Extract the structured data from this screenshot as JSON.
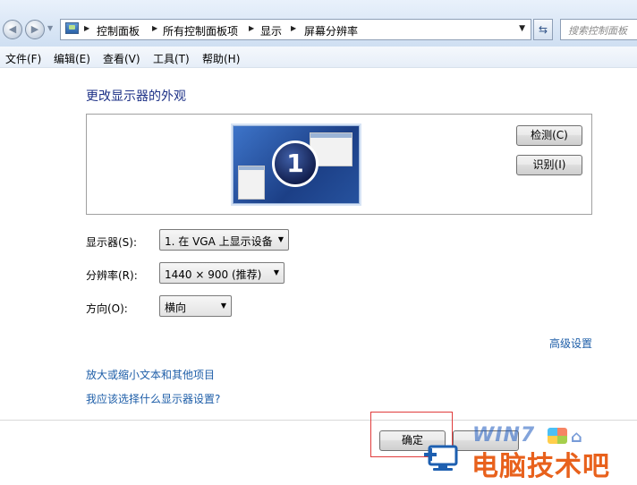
{
  "address_bar": {
    "breadcrumbs": [
      "控制面板",
      "所有控制面板项",
      "显示",
      "屏幕分辨率"
    ],
    "search_placeholder": "搜索控制面板"
  },
  "menu": [
    "文件(F)",
    "编辑(E)",
    "查看(V)",
    "工具(T)",
    "帮助(H)"
  ],
  "main": {
    "heading": "更改显示器的外观",
    "monitor_number": "1",
    "detect_button": "检测(C)",
    "identify_button": "识别(I)",
    "display_label": "显示器(S):",
    "display_value": "1. 在 VGA 上显示设备",
    "resolution_label": "分辨率(R):",
    "resolution_value": "1440 × 900 (推荐)",
    "orientation_label": "方向(O):",
    "orientation_value": "横向",
    "advanced_link": "高级设置",
    "link_text_size": "放大或缩小文本和其他项目",
    "link_which_settings": "我应该选择什么显示器设置?"
  },
  "footer": {
    "ok_button": "确定"
  },
  "watermark": {
    "brand": "WIN7",
    "site": "电脑技术吧"
  }
}
